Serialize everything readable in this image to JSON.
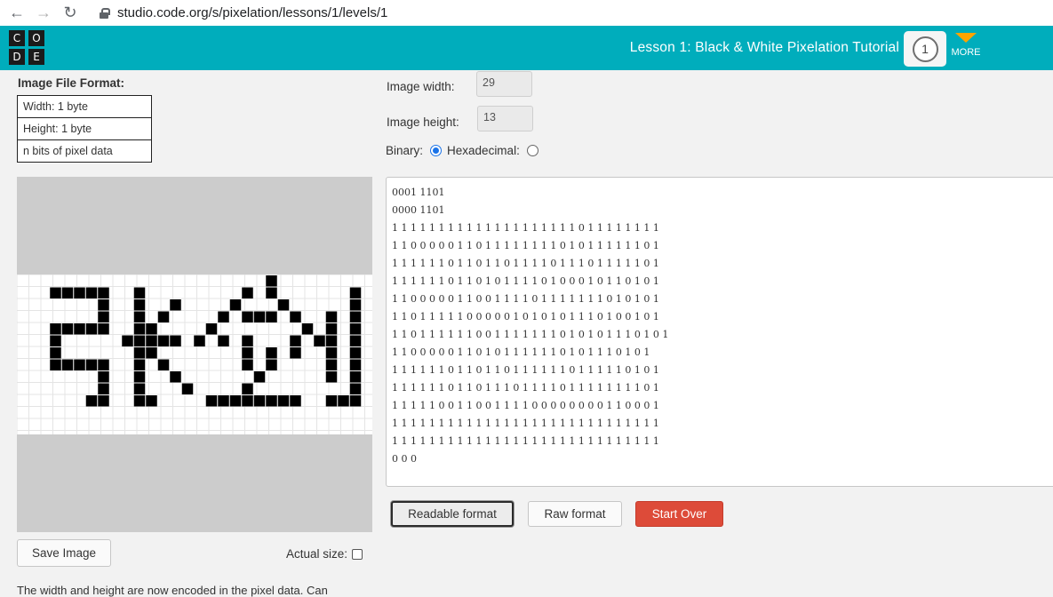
{
  "browser": {
    "url": "studio.code.org/s/pixelation/lessons/1/levels/1",
    "back_glyph": "←",
    "forward_glyph": "→",
    "reload_glyph": "↻"
  },
  "header": {
    "logo_letters": [
      "C",
      "O",
      "D",
      "E"
    ],
    "lesson_title": "Lesson 1: Black & White Pixelation Tutorial",
    "level_number": "1",
    "more_label": "MORE",
    "bar_color": "#00adbc",
    "more_arrow_color": "#ffa400"
  },
  "format_panel": {
    "title": "Image File Format:",
    "rows": [
      "Width: 1 byte",
      "Height: 1 byte",
      "n bits of pixel data"
    ]
  },
  "fields": {
    "width_label": "Image width:",
    "width_value": "29",
    "height_label": "Image height:",
    "height_value": "13",
    "binary_label": "Binary:",
    "hex_label": "Hexadecimal:",
    "selected_format": "Binary"
  },
  "data_text": {
    "lines": [
      "0001 1101",
      "0000 1101",
      "1 1 1 1 1 1 1 1 1 1 1 1 1 1 1 1 1 1 1 1 0 1 1 1 1 1 1 1 1",
      "1 1 0 0 0 0 0 1 1 0 1 1 1 1 1 1 1 1 0 1 0 1 1 1 1 1 1 0 1",
      "1 1 1 1 1 1 0 1 1 0 1 1 0 1 1 1 1 0 1 1 1 0 1 1 1 1 1 0 1",
      "1 1 1 1 1 1 0 1 1 0 1 0 1 1 1 1 0 1 0 0 0 1 0 1 1 0 1 0 1",
      "1 1 0 0 0 0 0 1 1 0 0 1 1 1 1 0 1 1 1 1 1 1 1 0 1 0 1 0 1",
      "1 1 0 1 1 1 1 1 0 0 0 0 0 1 0 1 0 1 0 1 1 1 0 1 0 0 1 0 1",
      "1 1 0 1 1 1 1 1 1 0 0 1 1 1 1 1 1 1 0 1 0 1 0 1 1 1 0 1 0 1",
      "1 1 0 0 0 0 0 1 1 0 1 0 1 1 1 1 1 1 0 1 0 1 1 1 0 1 0 1",
      "1 1 1 1 1 1 0 1 1 0 1 1 0 1 1 1 1 1 1 0 1 1 1 1 1 0 1 0 1",
      "1 1 1 1 1 1 0 1 1 0 1 1 1 0 1 1 1 1 0 1 1 1 1 1 1 1 1 0 1",
      "1 1 1 1 1 0 0 1 1 0 0 1 1 1 1 0 0 0 0 0 0 0 0 1 1 0 0 0 1",
      "1 1 1 1 1 1 1 1 1 1 1 1 1 1 1 1 1 1 1 1 1 1 1 1 1 1 1 1 1",
      "1 1 1 1 1 1 1 1 1 1 1 1 1 1 1 1 1 1 1 1 1 1 1 1 1 1 1 1 1",
      "0 0 0"
    ]
  },
  "pixel_grid": {
    "rows": [
      "11111111111111111111011111111",
      "11000001101111111101011111101",
      "11111101101101111011101111101",
      "11111101101011110100010110101",
      "11000001100111101111111010101",
      "11011111000001010101110100101",
      "11011111100111111101010110101",
      "11000001101011111101011110101",
      "11111101101101111110111110101",
      "11111101101110111101111111101",
      "11111001100111100000000110001",
      "11111111111111111111111111111",
      "11111111111111111111111111111"
    ],
    "on_color": "#000000",
    "off_color": "#ffffff"
  },
  "buttons": {
    "readable": "Readable format",
    "raw": "Raw format",
    "start_over": "Start Over",
    "save_image": "Save Image",
    "start_over_color": "#dd4b39"
  },
  "actual_size_label": "Actual size:",
  "footer_text": "The width and height are now encoded in the pixel data. Can"
}
